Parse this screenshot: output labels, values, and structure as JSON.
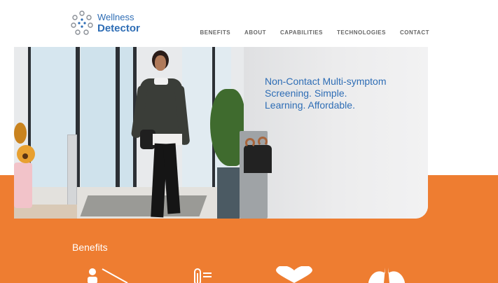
{
  "brand": {
    "line1": "Wellness",
    "line2": "Detector",
    "accent": "#2e6db5",
    "mark_icon": "dots-ring-logo-icon"
  },
  "nav": {
    "items": [
      {
        "label": "BENEFITS"
      },
      {
        "label": "ABOUT"
      },
      {
        "label": "CAPABILITIES"
      },
      {
        "label": "TECHNOLOGIES"
      },
      {
        "label": "CONTACT"
      }
    ]
  },
  "hero": {
    "headline_lines": [
      "Non-Contact Multi-symptom",
      "Screening. Simple.",
      "Learning. Affordable."
    ],
    "image_description_icon": "woman-walking-through-doorway-photo"
  },
  "benefits": {
    "title": "Benefits",
    "band_color": "#ee7d31",
    "icons": [
      "person-distance-icon",
      "thermometer-icon",
      "heart-icon",
      "lungs-icon"
    ]
  }
}
